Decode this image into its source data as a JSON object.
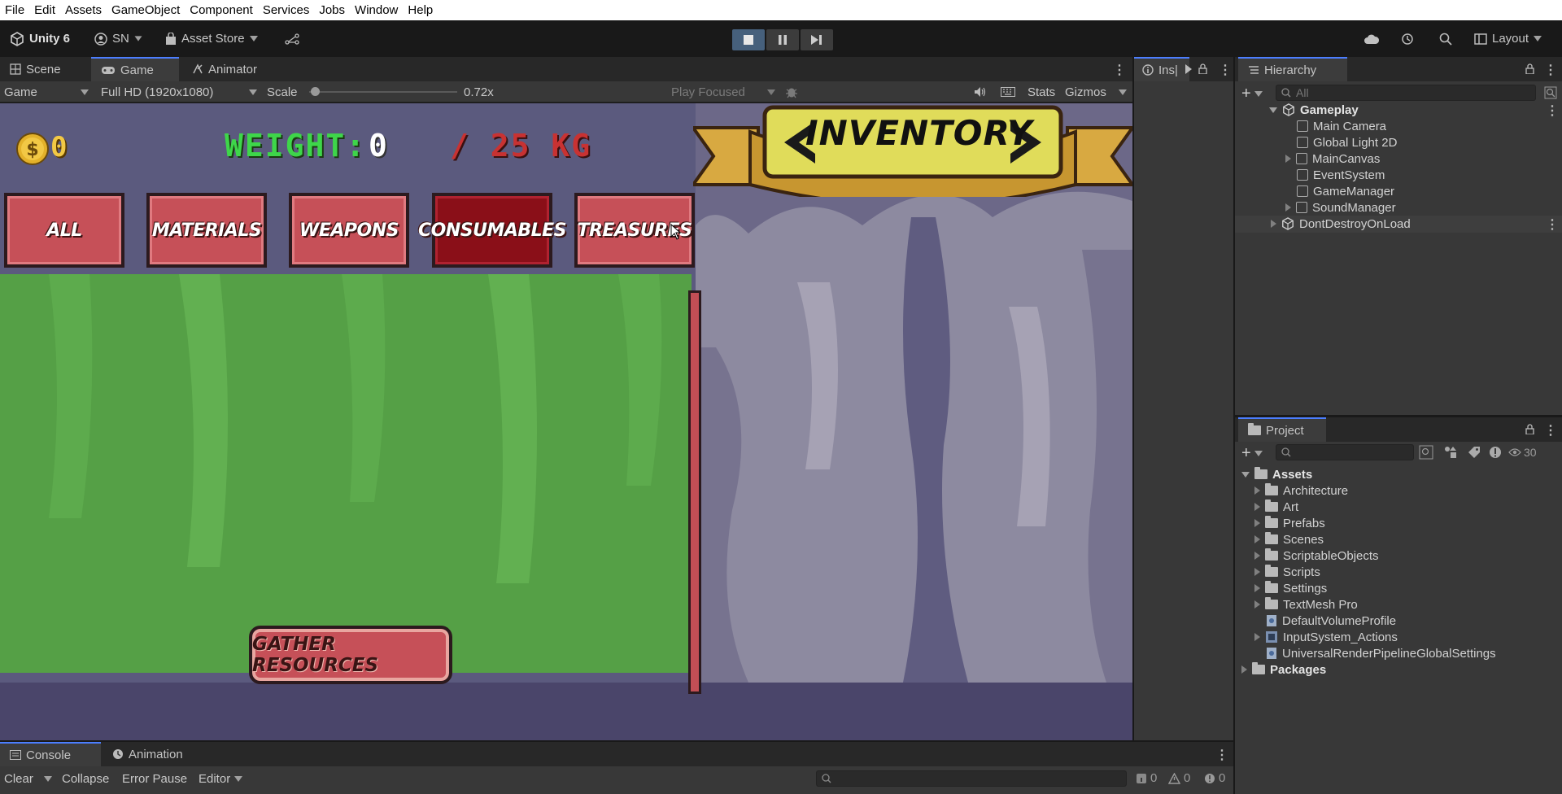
{
  "menubar": {
    "items": [
      "File",
      "Edit",
      "Assets",
      "GameObject",
      "Component",
      "Services",
      "Jobs",
      "Window",
      "Help"
    ]
  },
  "toolbar": {
    "unity_label": "Unity 6",
    "account_label": "SN",
    "asset_store_label": "Asset Store",
    "layout_label": "Layout"
  },
  "scene_tabs": {
    "scene": "Scene",
    "game": "Game",
    "animator": "Animator"
  },
  "inspector_tab": {
    "label": "Ins|"
  },
  "game_bar": {
    "display": "Game",
    "resolution": "Full HD (1920x1080)",
    "scale_label": "Scale",
    "scale_value": "0.72x",
    "play_focused": "Play Focused",
    "stats": "Stats",
    "gizmos": "Gizmos",
    "scale_fraction": 0.04
  },
  "game_ui": {
    "coins": "0",
    "weight_label": "WEIGHT:",
    "weight_value": "0",
    "weight_max": "/ 25 KG",
    "inventory_title": "INVENTORY",
    "categories": [
      "ALL",
      "MATERIALS",
      "WEAPONS",
      "CONSUMABLES",
      "TREASURES"
    ],
    "selected_category": "CONSUMABLES",
    "gather_button": "GATHER RESOURCES"
  },
  "hierarchy": {
    "title": "Hierarchy",
    "search_placeholder": "All",
    "scene_name": "Gameplay",
    "items": [
      "Main Camera",
      "Global Light 2D",
      "MainCanvas",
      "EventSystem",
      "GameManager",
      "SoundManager"
    ],
    "dont_destroy": "DontDestroyOnLoad"
  },
  "project": {
    "title": "Project",
    "hidden_count": "30",
    "root": "Assets",
    "folders": [
      "Architecture",
      "Art",
      "Prefabs",
      "Scenes",
      "ScriptableObjects",
      "Scripts",
      "Settings",
      "TextMesh Pro"
    ],
    "files": [
      "DefaultVolumeProfile",
      "InputSystem_Actions",
      "UniversalRenderPipelineGlobalSettings"
    ],
    "packages": "Packages"
  },
  "console": {
    "tab_console": "Console",
    "tab_animation": "Animation",
    "clear": "Clear",
    "collapse": "Collapse",
    "error_pause": "Error Pause",
    "editor": "Editor",
    "log_count": "0",
    "warn_count": "0",
    "error_count": "0"
  },
  "colors": {
    "accent": "#4c7eff",
    "play_active": "#46607c",
    "weight_green": "#3ed64a",
    "weight_red": "#c83232",
    "button_red": "#c65058",
    "button_selected": "#8a0f18"
  }
}
